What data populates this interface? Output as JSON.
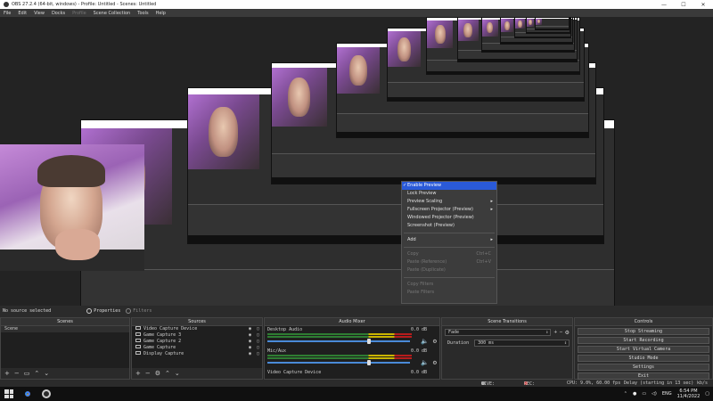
{
  "window": {
    "title": "OBS 27.2.4 (64-bit, windows) - Profile: Untitled - Scenes: Untitled",
    "controls": {
      "minimize": "—",
      "maximize": "☐",
      "close": "✕"
    }
  },
  "menu": [
    "File",
    "Edit",
    "View",
    "Docks",
    "Profile",
    "Scene Collection",
    "Tools",
    "Help"
  ],
  "context_menu": {
    "items": [
      {
        "label": "Enable Preview",
        "selected": true,
        "checked": true
      },
      {
        "label": "Lock Preview"
      },
      {
        "label": "Preview Scaling",
        "submenu": true
      },
      {
        "label": "Fullscreen Projector (Preview)",
        "submenu": true
      },
      {
        "label": "Windowed Projector (Preview)"
      },
      {
        "label": "Screenshot (Preview)"
      },
      {
        "label": "Add",
        "submenu": true
      },
      {
        "label": "Copy",
        "shortcut": "Ctrl+C",
        "disabled": true
      },
      {
        "label": "Paste (Reference)",
        "shortcut": "Ctrl+V",
        "disabled": true
      },
      {
        "label": "Paste (Duplicate)",
        "disabled": true
      },
      {
        "label": "Copy Filters",
        "disabled": true
      },
      {
        "label": "Paste Filters",
        "disabled": true
      }
    ]
  },
  "status_row": {
    "selection": "No source selected",
    "properties_label": "Properties",
    "filters_label": "Filters"
  },
  "scenes": {
    "title": "Scenes",
    "items": [
      "Scene"
    ]
  },
  "sources": {
    "title": "Sources",
    "items": [
      "Video Capture Device",
      "Game Capture 3",
      "Game Capture 2",
      "Game Capture",
      "Display Capture"
    ]
  },
  "audio_mixer": {
    "title": "Audio Mixer",
    "channels": [
      {
        "name": "Desktop Audio",
        "db": "0.0 dB",
        "level": 0.7
      },
      {
        "name": "Mic/Aux",
        "db": "0.0 dB",
        "level": 0.7
      },
      {
        "name": "Video Capture Device",
        "db": "0.0 dB",
        "level": 0.7
      }
    ]
  },
  "transitions": {
    "title": "Scene Transitions",
    "type": "Fade",
    "duration_label": "Duration",
    "duration_value": "300 ms"
  },
  "controls": {
    "title": "Controls",
    "buttons": [
      "Stop Streaming",
      "Start Recording",
      "Start Virtual Camera",
      "Studio Mode",
      "Settings",
      "Exit"
    ]
  },
  "statusbar": {
    "live": "LIVE: 00:00:02",
    "rec": "REC: 00:00:00",
    "cpu": "CPU: 9.0%, 60.00 fps",
    "delay": "Delay (starting in 13 sec)",
    "kbps": "kb/s"
  },
  "taskbar": {
    "language": "ENG",
    "time": "6:54 PM",
    "date": "11/4/2022"
  },
  "icons": {
    "eye": "eye-icon",
    "lock": "lock-icon",
    "gear": "gear-icon",
    "speaker": "speaker-icon",
    "windows": "windows-logo-icon",
    "chrome": "chrome-icon",
    "obs": "obs-icon"
  },
  "colors": {
    "accent": "#2a5ad8",
    "background": "#2b2b2b",
    "rec": "#d03030"
  }
}
